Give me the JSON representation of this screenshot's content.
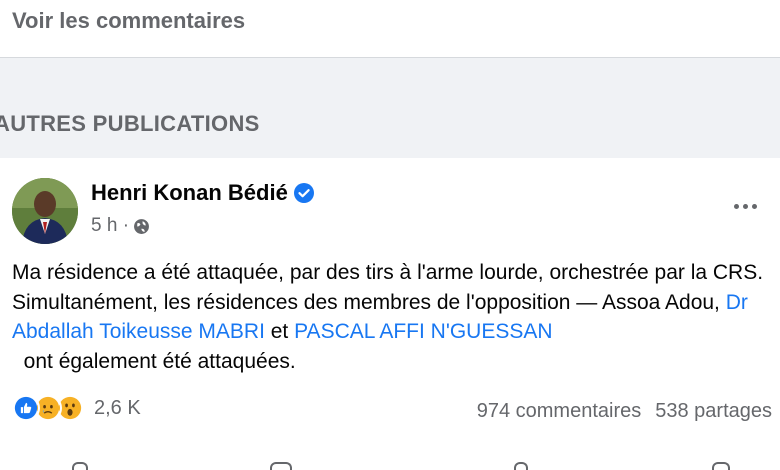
{
  "comments_link": "Voir les commentaires",
  "section_title": "AUTRES PUBLICATIONS",
  "post": {
    "author": "Henri Konan Bédié",
    "time": "5 h ·",
    "text_parts": {
      "p1": "Ma résidence a été attaquée, par des tirs à l'arme lourde, orchestrée par la CRS. Simultanément, les résidences des membres de l'opposition — Assoa Adou, ",
      "link1": "Dr Abdallah Toikeusse MABRI",
      "p2": " et ",
      "link2": "PASCAL AFFI N'GUESSAN",
      "p3": "  ont également été attaquées."
    },
    "reaction_count": "2,6 K",
    "comments_count": "974 commentaires",
    "shares_count": "538 partages",
    "reactions": [
      "like-icon",
      "sad-icon",
      "wow-icon"
    ]
  },
  "colors": {
    "link": "#1877f2",
    "verified": "#1877f2",
    "secondary_text": "#65676b"
  }
}
